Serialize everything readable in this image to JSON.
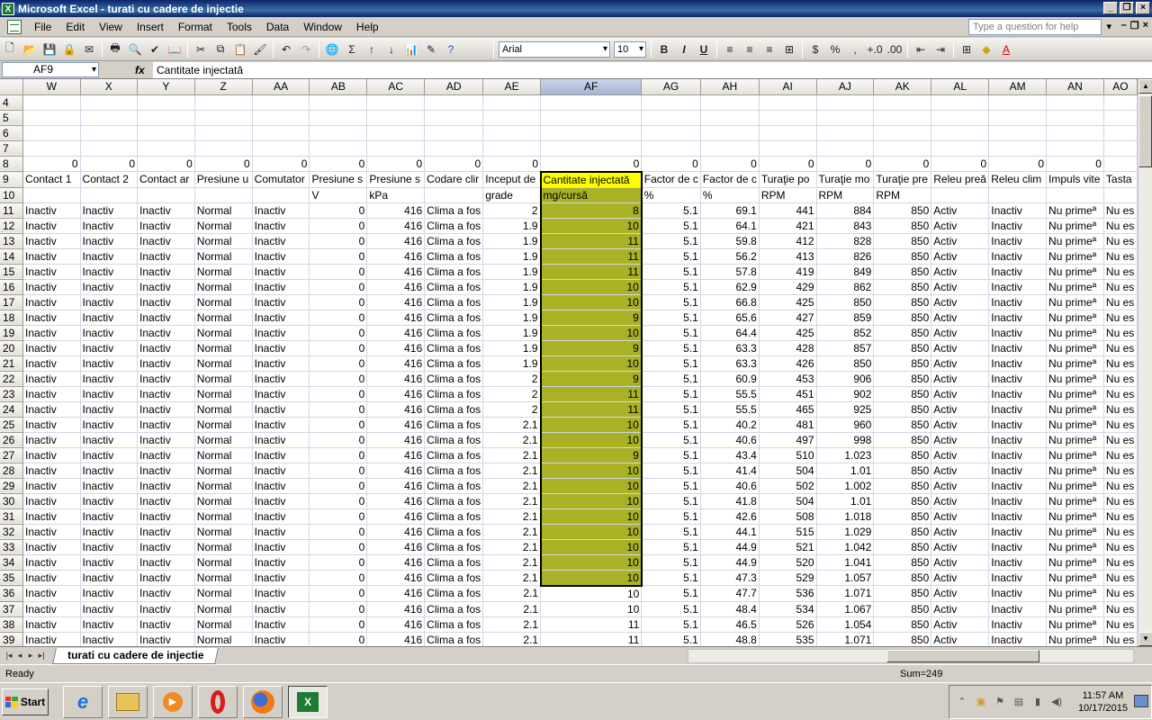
{
  "window": {
    "title": "Microsoft Excel - turati cu cadere de injectie"
  },
  "menu": {
    "items": [
      "File",
      "Edit",
      "View",
      "Insert",
      "Format",
      "Tools",
      "Data",
      "Window",
      "Help"
    ],
    "ask_placeholder": "Type a question for help"
  },
  "toolbar": {
    "font": "Arial",
    "font_size": "10",
    "bold": "B",
    "italic": "I",
    "underline": "U",
    "currency": "$",
    "percent": "%",
    "comma": ",",
    "sum": "Σ"
  },
  "formula_bar": {
    "name_box": "AF9",
    "fx": "fx",
    "content": "Cantitate injectată"
  },
  "sheet": {
    "columns": [
      "W",
      "X",
      "Y",
      "Z",
      "AA",
      "AB",
      "AC",
      "AD",
      "AE",
      "AF",
      "AG",
      "AH",
      "AI",
      "AJ",
      "AK",
      "AL",
      "AM",
      "AN",
      "AO"
    ],
    "row_labels": [
      "4",
      "5",
      "6",
      "7",
      "8",
      "9",
      "10",
      "11",
      "12",
      "13",
      "14",
      "15",
      "16",
      "17",
      "18",
      "19",
      "20",
      "21",
      "22",
      "23",
      "24",
      "25",
      "26",
      "27",
      "28",
      "29",
      "30",
      "31",
      "32",
      "33",
      "34",
      "35",
      "36",
      "37",
      "38",
      "39"
    ],
    "zeros_row": [
      "0",
      "0",
      "0",
      "0",
      "0",
      "0",
      "0",
      "0",
      "0",
      "0",
      "0",
      "0",
      "0",
      "0",
      "0",
      "0",
      "0",
      "0",
      ""
    ],
    "headers": [
      "Contact 1",
      "Contact 2",
      "Contact ar",
      "Presiune u",
      "Comutator",
      "Presiune s",
      "Presiune s",
      "Codare clir",
      "Inceput de",
      "Cantitate injectată",
      "Factor de c",
      "Factor de c",
      "Turaţie po",
      "Turaţie mo",
      "Turaţie pre",
      "Releu preă",
      "Releu clim",
      "Impuls vite",
      "Tasta"
    ],
    "units": [
      "",
      "",
      "",
      "",
      "",
      "V",
      "kPa",
      "",
      "grade",
      "mg/cursă",
      "%",
      "%",
      "RPM",
      "RPM",
      "RPM",
      "",
      "",
      "",
      ""
    ],
    "data": [
      [
        "2",
        "8",
        "69.1",
        "441",
        "884"
      ],
      [
        "1.9",
        "10",
        "64.1",
        "421",
        "843"
      ],
      [
        "1.9",
        "11",
        "59.8",
        "412",
        "828"
      ],
      [
        "1.9",
        "11",
        "56.2",
        "413",
        "826"
      ],
      [
        "1.9",
        "11",
        "57.8",
        "419",
        "849"
      ],
      [
        "1.9",
        "10",
        "62.9",
        "429",
        "862"
      ],
      [
        "1.9",
        "10",
        "66.8",
        "425",
        "850"
      ],
      [
        "1.9",
        "9",
        "65.6",
        "427",
        "859"
      ],
      [
        "1.9",
        "10",
        "64.4",
        "425",
        "852"
      ],
      [
        "1.9",
        "9",
        "63.3",
        "428",
        "857"
      ],
      [
        "1.9",
        "10",
        "63.3",
        "426",
        "850"
      ],
      [
        "2",
        "9",
        "60.9",
        "453",
        "906"
      ],
      [
        "2",
        "11",
        "55.5",
        "451",
        "902"
      ],
      [
        "2",
        "11",
        "55.5",
        "465",
        "925"
      ],
      [
        "2.1",
        "10",
        "40.2",
        "481",
        "960"
      ],
      [
        "2.1",
        "10",
        "40.6",
        "497",
        "998"
      ],
      [
        "2.1",
        "9",
        "43.4",
        "510",
        "1.023"
      ],
      [
        "2.1",
        "10",
        "41.4",
        "504",
        "1.01"
      ],
      [
        "2.1",
        "10",
        "40.6",
        "502",
        "1.002"
      ],
      [
        "2.1",
        "10",
        "41.8",
        "504",
        "1.01"
      ],
      [
        "2.1",
        "10",
        "42.6",
        "508",
        "1.018"
      ],
      [
        "2.1",
        "10",
        "44.1",
        "515",
        "1.029"
      ],
      [
        "2.1",
        "10",
        "44.9",
        "521",
        "1.042"
      ],
      [
        "2.1",
        "10",
        "44.9",
        "520",
        "1.041"
      ],
      [
        "2.1",
        "10",
        "47.3",
        "529",
        "1.057"
      ],
      [
        "2.1",
        "10",
        "47.7",
        "536",
        "1.071"
      ],
      [
        "2.1",
        "10",
        "48.4",
        "534",
        "1.067"
      ],
      [
        "2.1",
        "11",
        "46.5",
        "526",
        "1.054"
      ],
      [
        "2.1",
        "11",
        "48.8",
        "535",
        "1.071"
      ]
    ],
    "const": {
      "w": "Inactiv",
      "x": "Inactiv",
      "y": "Inactiv",
      "z": "Normal",
      "aa": "Inactiv",
      "ab": "0",
      "ac": "416",
      "ad": "Clima a fos",
      "ag": "5.1",
      "ak": "850",
      "al": "Activ",
      "am": "Inactiv",
      "an": "Nu primeª",
      "ao": "Nu es"
    }
  },
  "sheet_tab": "turati cu cadere de injectie",
  "status": {
    "ready": "Ready",
    "sum": "Sum=249"
  },
  "taskbar": {
    "start": "Start",
    "time": "11:57 AM",
    "date": "10/17/2015"
  },
  "colors": {
    "selection": "#a9b224",
    "active_header": "#ffff00",
    "title_bar": "#0a246a"
  }
}
